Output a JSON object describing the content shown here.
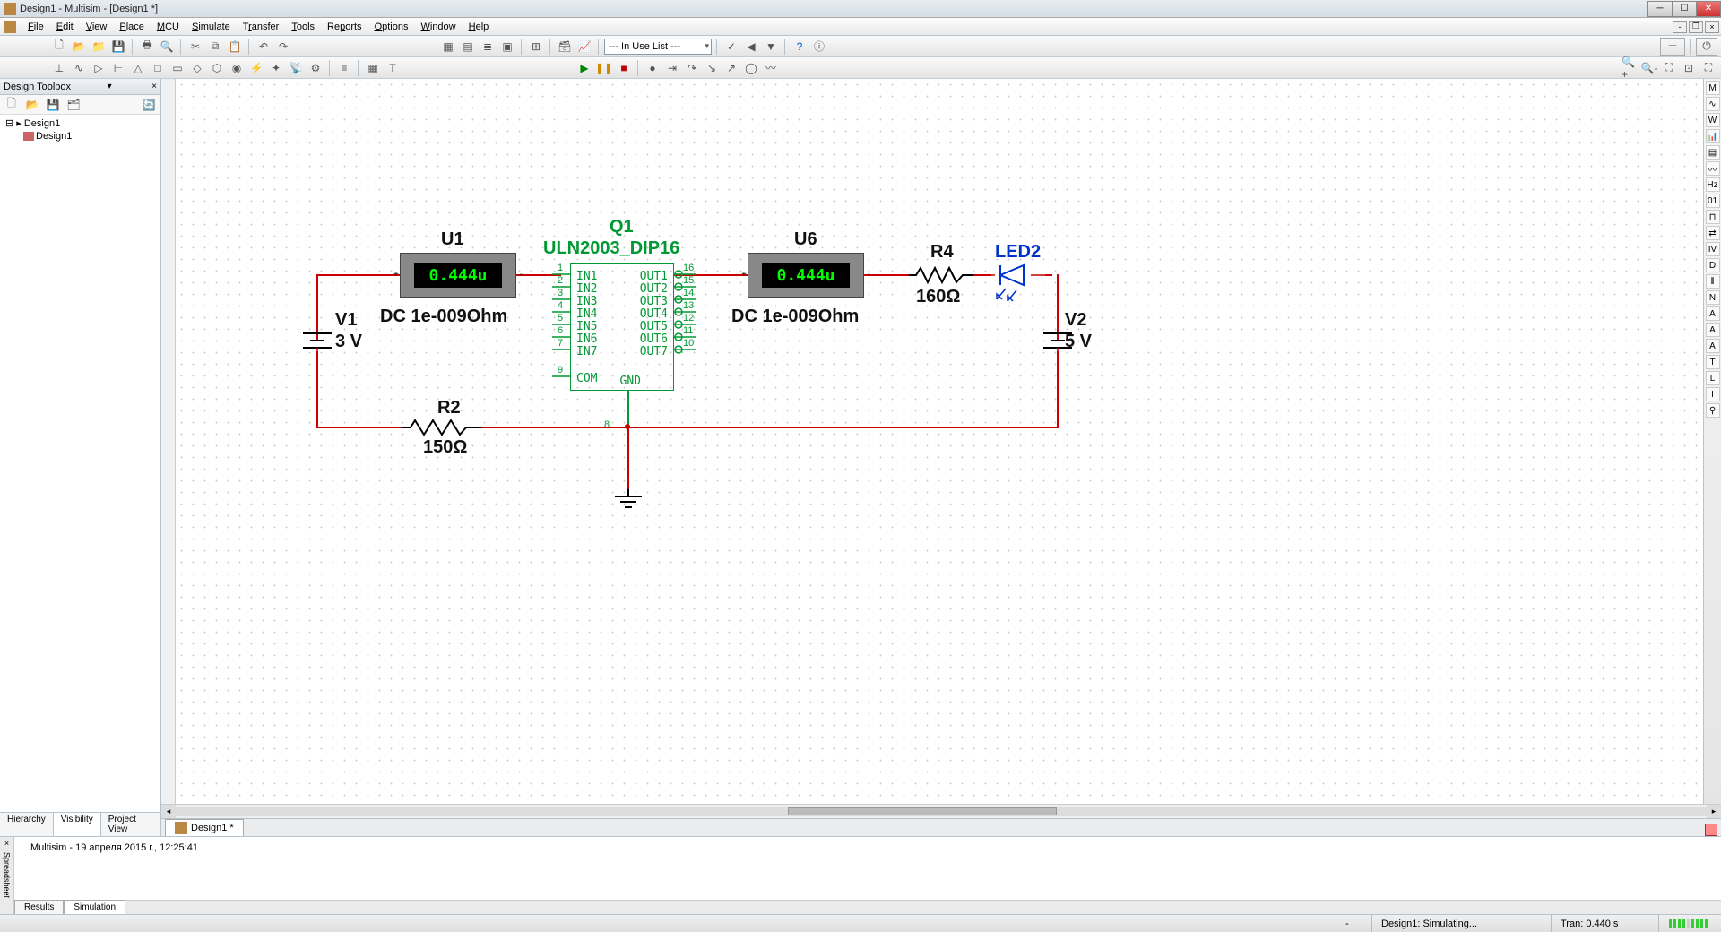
{
  "title": "Design1 - Multisim - [Design1 *]",
  "menu": [
    "File",
    "Edit",
    "View",
    "Place",
    "MCU",
    "Simulate",
    "Transfer",
    "Tools",
    "Reports",
    "Options",
    "Window",
    "Help"
  ],
  "combo": "--- In Use List ---",
  "toolbox": {
    "header": "Design Toolbox",
    "root": "Design1",
    "child": "Design1",
    "tabs": [
      "Hierarchy",
      "Visibility",
      "Project View"
    ],
    "active_tab": 1
  },
  "doc_tab": "Design1 *",
  "bottom": {
    "msg": "Multisim  -  19 апреля 2015 г., 12:25:41",
    "tabs": [
      "Results",
      "Simulation"
    ],
    "active_tab": 1,
    "side": "Spreadsheet"
  },
  "status": {
    "sim": "Design1: Simulating...",
    "tran": "Tran: 0.440 s"
  },
  "circuit": {
    "Q1": {
      "ref": "Q1",
      "value": "ULN2003_DIP16",
      "in": [
        "IN1",
        "IN2",
        "IN3",
        "IN4",
        "IN5",
        "IN6",
        "IN7"
      ],
      "out": [
        "OUT1",
        "OUT2",
        "OUT3",
        "OUT4",
        "OUT5",
        "OUT6",
        "OUT7"
      ],
      "com": "COM",
      "gnd": "GND",
      "pins_left": [
        "1",
        "2",
        "3",
        "4",
        "5",
        "6",
        "7",
        "9"
      ],
      "pins_right": [
        "16",
        "15",
        "14",
        "13",
        "12",
        "11",
        "10"
      ],
      "pin_gnd": "8"
    },
    "U1": {
      "ref": "U1",
      "reading": "0.444u",
      "dc": "DC  1e-009Ohm"
    },
    "U6": {
      "ref": "U6",
      "reading": "0.444u",
      "dc": "DC  1e-009Ohm"
    },
    "V1": {
      "ref": "V1",
      "value": "3 V"
    },
    "V2": {
      "ref": "V2",
      "value": "5 V"
    },
    "R2": {
      "ref": "R2",
      "value": "150Ω"
    },
    "R4": {
      "ref": "R4",
      "value": "160Ω"
    },
    "LED2": {
      "ref": "LED2"
    }
  }
}
